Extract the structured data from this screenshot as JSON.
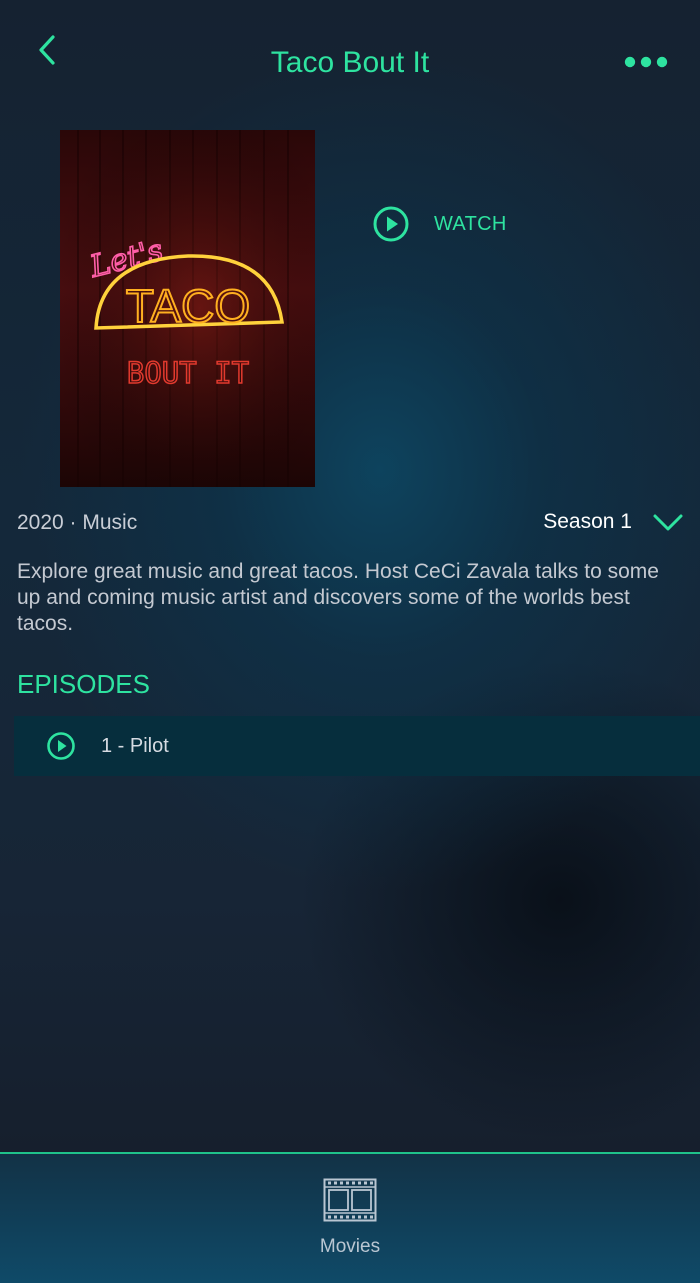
{
  "header": {
    "title": "Taco Bout It",
    "back_icon": "chevron-left-icon",
    "more_icon": "more-dots-icon"
  },
  "poster": {
    "line1": "Let's",
    "line2": "TACO",
    "line3": "BOUT IT"
  },
  "watch": {
    "label": "WATCH",
    "icon": "play-circle-icon"
  },
  "meta": {
    "text": "2020 · Music"
  },
  "season": {
    "label": "Season 1",
    "icon": "chevron-down-icon"
  },
  "description": "Explore great music and great tacos. Host CeCi Zavala talks to some up and coming music artist and discovers some of the worlds best tacos.",
  "episodes": {
    "heading": "EPISODES",
    "items": [
      {
        "label": "1 - Pilot",
        "icon": "play-circle-icon"
      }
    ]
  },
  "bottom_nav": {
    "items": [
      {
        "label": "Movies",
        "icon": "film-strip-icon"
      }
    ]
  },
  "colors": {
    "accent": "#2ee3a0",
    "background": "#161d29",
    "episode_row": "#062e3d",
    "nav_border": "#1fc28a"
  }
}
